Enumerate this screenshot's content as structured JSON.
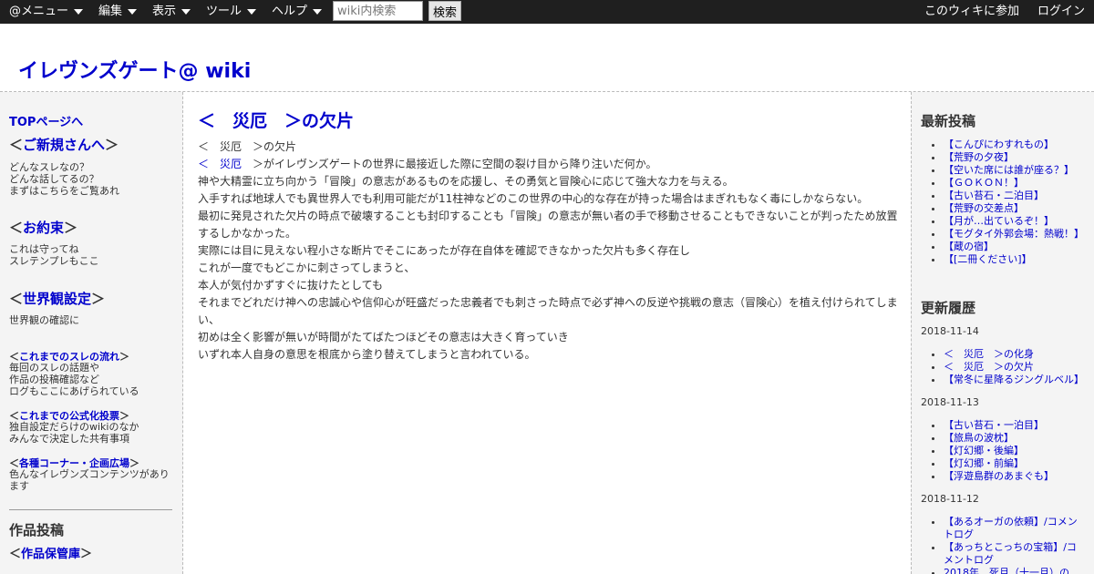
{
  "topbar": {
    "menus": [
      "@メニュー",
      "編集",
      "表示",
      "ツール",
      "ヘルプ"
    ],
    "search_placeholder": "wiki内検索",
    "search_button": "検索",
    "join": "このウィキに参加",
    "login": "ログイン"
  },
  "site": {
    "title": "イレヴンズゲート@ wiki"
  },
  "left": {
    "top_link": "TOPページへ",
    "sections": [
      {
        "prefix": "＜",
        "label": "ご新規さんへ",
        "suffix": "＞",
        "desc": [
          "どんなスレなの？",
          "どんな話してるの？",
          "まずはこちらをご覧あれ"
        ]
      },
      {
        "prefix": "＜",
        "label": "お約束",
        "suffix": "＞",
        "desc": [
          "これは守ってね",
          "スレテンプレもここ"
        ]
      },
      {
        "prefix": "＜",
        "label": "世界観設定",
        "suffix": "＞",
        "desc": [
          "世界観の確認に"
        ]
      }
    ],
    "subsections": [
      {
        "prefix": "＜",
        "label": "これまでのスレの流れ",
        "suffix": "＞",
        "desc": [
          "毎回のスレの話題や",
          "作品の投稿確認など",
          "ログもここにあげられている"
        ]
      },
      {
        "prefix": "＜",
        "label": "これまでの公式化投票",
        "suffix": "＞",
        "desc": [
          "独自設定だらけのwikiのなか",
          "みんなで決定した共有事項"
        ]
      },
      {
        "prefix": "＜",
        "label": "各種コーナー・企画広場",
        "suffix": "＞",
        "desc": [
          "色んなイレヴンズコンテンツがあります"
        ]
      }
    ],
    "works_title": "作品投稿",
    "works_link": {
      "prefix": "＜",
      "label": "作品保管庫",
      "suffix": "＞"
    }
  },
  "main": {
    "title": "＜　災厄　＞の欠片",
    "line1": "＜　災厄　＞の欠片",
    "line2_link": "＜　災厄　",
    "line2_rest": "＞がイレヴンズゲートの世界に最接近した際に空間の裂け目から降り注いだ何か。",
    "lines": [
      "神や大精霊に立ち向かう「冒険」の意志があるものを応援し、その勇気と冒険心に応じて強大な力を与える。",
      "入手すれば地球人でも異世界人でも利用可能だが11柱神などのこの世界の中心的な存在が持った場合はまぎれもなく毒にしかならない。",
      "最初に発見された欠片の時点で破壊することも封印することも「冒険」の意志が無い者の手で移動させることもできないことが判ったため放置するしかなかった。",
      "実際には目に見えない程小さな断片でそこにあったが存在自体を確認できなかった欠片も多く存在し",
      "これが一度でもどこかに刺さってしまうと、",
      "本人が気付かずすぐに抜けたとしても",
      "それまでどれだけ神への忠誠心や信仰心が旺盛だった忠義者でも刺さった時点で必ず神への反逆や挑戦の意志（冒険心）を植え付けられてしまい、",
      "初めは全く影響が無いが時間がたてばたつほどその意志は大きく育っていき",
      "いずれ本人自身の意思を根底から塗り替えてしまうと言われている。"
    ]
  },
  "right": {
    "latest_title": "最新投稿",
    "latest": [
      "【こんぴにわすれもの】",
      "【荒野の夕夜】",
      "【空いた席には誰が座る？】",
      "【ＧＯＫＯＮ！】",
      "【古い苔石・二泊目】",
      "【荒野の交差点】",
      "【月が…出ているぞ！】",
      "【モグタイ外郭会場：熱戦！】",
      "【蔵の宿】",
      "【[二冊ください]】"
    ],
    "history_title": "更新履歴",
    "history": [
      {
        "date": "2018-11-14",
        "items": [
          "＜　災厄　＞の化身",
          "＜　災厄　＞の欠片",
          "【常冬に星降るジングルベル】"
        ]
      },
      {
        "date": "2018-11-13",
        "items": [
          "【古い苔石・一泊目】",
          "【旅鳥の波枕】",
          "【灯幻郷・後編】",
          "【灯幻郷・前編】",
          "【浮遊島群のあまぐも】"
        ]
      },
      {
        "date": "2018-11-12",
        "items": [
          "【あるオーガの依頼】/コメントログ",
          "【あっちとこっちの宝箱】/コメントログ",
          "2018年　死月（十一月）の..."
        ]
      }
    ]
  }
}
